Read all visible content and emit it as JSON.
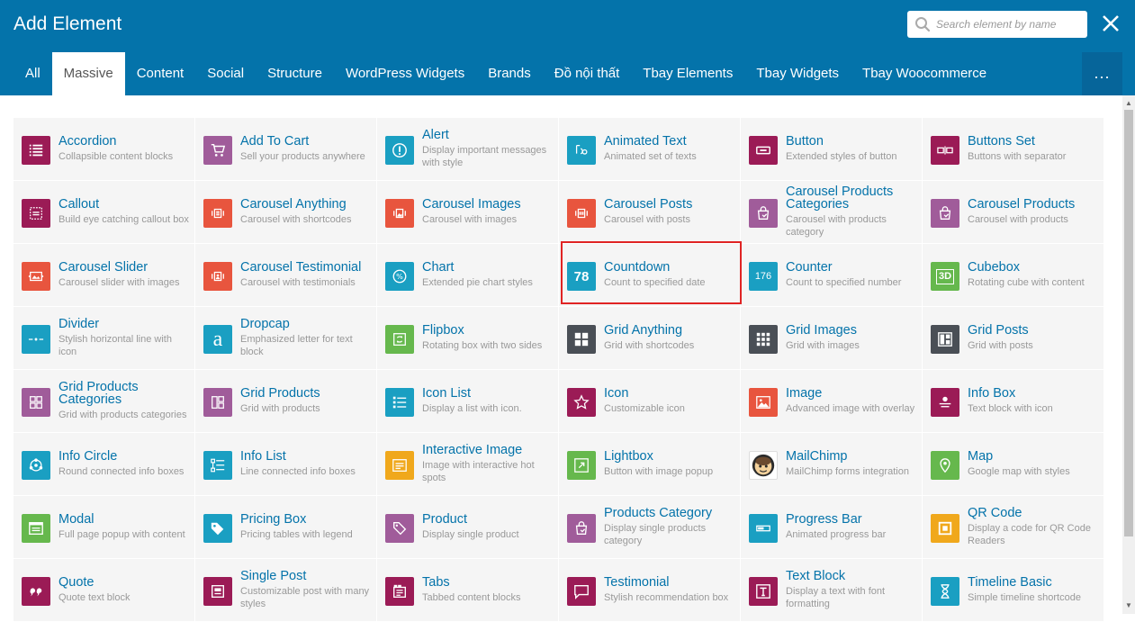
{
  "window": {
    "title": "Add Element"
  },
  "search": {
    "placeholder": "Search element by name"
  },
  "tabs": [
    "All",
    "Massive",
    "Content",
    "Social",
    "Structure",
    "WordPress Widgets",
    "Brands",
    "Đồ nội thất",
    "Tbay Elements",
    "Tbay Widgets",
    "Tbay Woocommerce"
  ],
  "active_tab": "Massive",
  "more_label": "...",
  "colors": {
    "header": "#0473aa",
    "link": "#0473aa",
    "desc": "#999999",
    "card_bg": "#f5f5f5",
    "highlight": "#e02424"
  },
  "elements": [
    {
      "name": "Accordion",
      "desc": "Collapsible content blocks",
      "color": "#9b1b56",
      "icon": "list-icon"
    },
    {
      "name": "Add To Cart",
      "desc": "Sell your products anywhere",
      "color": "#a05c9a",
      "icon": "cart-icon"
    },
    {
      "name": "Alert",
      "desc": "Display important messages with style",
      "color": "#1a9fc2",
      "icon": "alert-icon"
    },
    {
      "name": "Animated Text",
      "desc": "Animated set of texts",
      "color": "#1a9fc2",
      "icon": "animated-text-icon"
    },
    {
      "name": "Button",
      "desc": "Extended styles of button",
      "color": "#9b1b56",
      "icon": "button-icon"
    },
    {
      "name": "Buttons Set",
      "desc": "Buttons with separator",
      "color": "#9b1b56",
      "icon": "buttons-set-icon"
    },
    {
      "name": "Callout",
      "desc": "Build eye catching callout box",
      "color": "#9b1b56",
      "icon": "callout-icon"
    },
    {
      "name": "Carousel Anything",
      "desc": "Carousel with shortcodes",
      "color": "#e8553e",
      "icon": "carousel-icon"
    },
    {
      "name": "Carousel Images",
      "desc": "Carousel with images",
      "color": "#e8553e",
      "icon": "carousel-images-icon"
    },
    {
      "name": "Carousel Posts",
      "desc": "Carousel with posts",
      "color": "#e8553e",
      "icon": "carousel-posts-icon"
    },
    {
      "name": "Carousel Products Categories",
      "desc": "Carousel with products category",
      "color": "#a05c9a",
      "icon": "bag-icon"
    },
    {
      "name": "Carousel Products",
      "desc": "Carousel with products",
      "color": "#a05c9a",
      "icon": "bag-icon"
    },
    {
      "name": "Carousel Slider",
      "desc": "Carousel slider with images",
      "color": "#e8553e",
      "icon": "slider-icon"
    },
    {
      "name": "Carousel Testimonial",
      "desc": "Carousel with testimonials",
      "color": "#e8553e",
      "icon": "testimonial-carousel-icon"
    },
    {
      "name": "Chart",
      "desc": "Extended pie chart styles",
      "color": "#1a9fc2",
      "icon": "pie-chart-icon"
    },
    {
      "name": "Countdown",
      "desc": "Count to specified date",
      "color": "#1a9fc2",
      "icon": "countdown-icon",
      "glyph": "78"
    },
    {
      "name": "Counter",
      "desc": "Count to specified number",
      "color": "#1a9fc2",
      "icon": "counter-icon",
      "glyph": "176"
    },
    {
      "name": "Cubebox",
      "desc": "Rotating cube with content",
      "color": "#66b84d",
      "icon": "cube-icon",
      "glyph": "3D"
    },
    {
      "name": "Divider",
      "desc": "Stylish horizontal line with icon",
      "color": "#1a9fc2",
      "icon": "divider-icon"
    },
    {
      "name": "Dropcap",
      "desc": "Emphasized letter for text block",
      "color": "#1a9fc2",
      "icon": "dropcap-icon",
      "glyph": "a"
    },
    {
      "name": "Flipbox",
      "desc": "Rotating box with two sides",
      "color": "#66b84d",
      "icon": "flipbox-icon"
    },
    {
      "name": "Grid Anything",
      "desc": "Grid with shortcodes",
      "color": "#4a4f56",
      "icon": "grid-anything-icon"
    },
    {
      "name": "Grid Images",
      "desc": "Grid with images",
      "color": "#4a4f56",
      "icon": "grid-images-icon"
    },
    {
      "name": "Grid Posts",
      "desc": "Grid with posts",
      "color": "#4a4f56",
      "icon": "grid-posts-icon"
    },
    {
      "name": "Grid Products Categories",
      "desc": "Grid with products categories",
      "color": "#a05c9a",
      "icon": "grid-products-categories-icon"
    },
    {
      "name": "Grid Products",
      "desc": "Grid with products",
      "color": "#a05c9a",
      "icon": "grid-products-icon"
    },
    {
      "name": "Icon List",
      "desc": "Display a list with icon.",
      "color": "#1a9fc2",
      "icon": "icon-list-icon"
    },
    {
      "name": "Icon",
      "desc": "Customizable icon",
      "color": "#9b1b56",
      "icon": "star-icon"
    },
    {
      "name": "Image",
      "desc": "Advanced image with overlay",
      "color": "#e8553e",
      "icon": "image-icon"
    },
    {
      "name": "Info Box",
      "desc": "Text block with icon",
      "color": "#9b1b56",
      "icon": "info-box-icon"
    },
    {
      "name": "Info Circle",
      "desc": "Round connected info boxes",
      "color": "#1a9fc2",
      "icon": "info-circle-icon"
    },
    {
      "name": "Info List",
      "desc": "Line connected info boxes",
      "color": "#1a9fc2",
      "icon": "info-list-icon"
    },
    {
      "name": "Interactive Image",
      "desc": "Image with interactive hot spots",
      "color": "#f0a81c",
      "icon": "interactive-image-icon"
    },
    {
      "name": "Lightbox",
      "desc": "Button with image popup",
      "color": "#66b84d",
      "icon": "lightbox-icon"
    },
    {
      "name": "MailChimp",
      "desc": "MailChimp forms integration",
      "color": "#ffffff",
      "icon": "mailchimp-icon"
    },
    {
      "name": "Map",
      "desc": "Google map with styles",
      "color": "#66b84d",
      "icon": "map-pin-icon"
    },
    {
      "name": "Modal",
      "desc": "Full page popup with content",
      "color": "#66b84d",
      "icon": "modal-icon"
    },
    {
      "name": "Pricing Box",
      "desc": "Pricing tables with legend",
      "color": "#1a9fc2",
      "icon": "tag-icon"
    },
    {
      "name": "Product",
      "desc": "Display single product",
      "color": "#a05c9a",
      "icon": "product-tag-icon"
    },
    {
      "name": "Products Category",
      "desc": "Display single products category",
      "color": "#a05c9a",
      "icon": "bag-icon"
    },
    {
      "name": "Progress Bar",
      "desc": "Animated progress bar",
      "color": "#1a9fc2",
      "icon": "progress-bar-icon"
    },
    {
      "name": "QR Code",
      "desc": "Display a code for QR Code Readers",
      "color": "#f0a81c",
      "icon": "qr-code-icon"
    },
    {
      "name": "Quote",
      "desc": "Quote text block",
      "color": "#9b1b56",
      "icon": "quote-icon"
    },
    {
      "name": "Single Post",
      "desc": "Customizable post with many styles",
      "color": "#9b1b56",
      "icon": "single-post-icon"
    },
    {
      "name": "Tabs",
      "desc": "Tabbed content blocks",
      "color": "#9b1b56",
      "icon": "tabs-icon"
    },
    {
      "name": "Testimonial",
      "desc": "Stylish recommendation box",
      "color": "#9b1b56",
      "icon": "speech-bubble-icon"
    },
    {
      "name": "Text Block",
      "desc": "Display a text with font formatting",
      "color": "#9b1b56",
      "icon": "text-block-icon"
    },
    {
      "name": "Timeline Basic",
      "desc": "Simple timeline shortcode",
      "color": "#1a9fc2",
      "icon": "hourglass-icon"
    }
  ],
  "highlighted_element": "Countdown"
}
